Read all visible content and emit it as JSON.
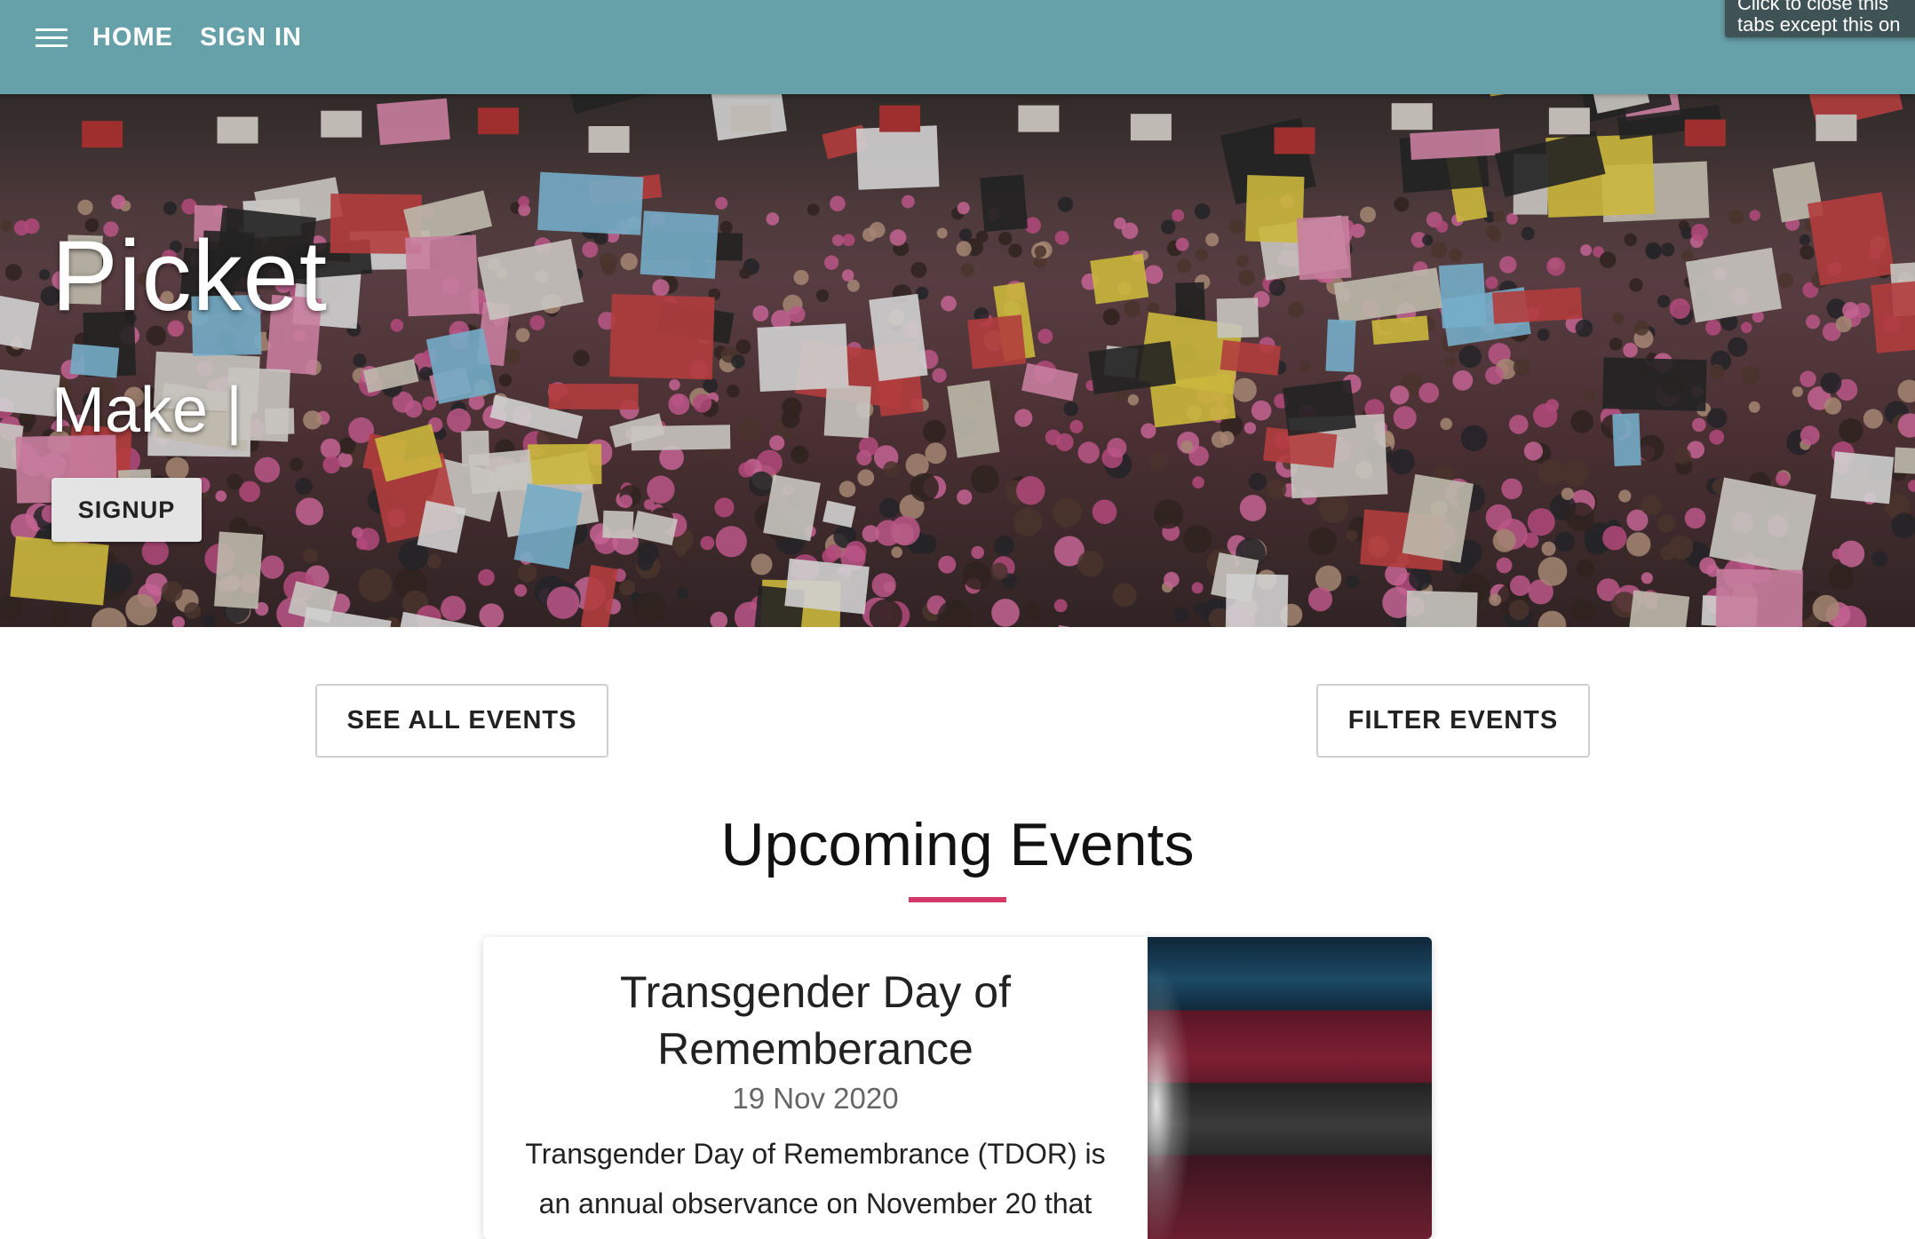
{
  "nav": {
    "menu_icon": "hamburger-menu-icon",
    "home_label": "HOME",
    "signin_label": "SIGN IN"
  },
  "tooltip": {
    "line1": "Click to close this",
    "line2": "tabs except this on"
  },
  "hero": {
    "title": "Picket",
    "subtitle": "Make |",
    "signup_label": "SIGNUP"
  },
  "actions": {
    "see_all_label": "SEE ALL EVENTS",
    "filter_label": "FILTER EVENTS"
  },
  "section": {
    "title": "Upcoming Events",
    "accent_color": "#d63866"
  },
  "events": [
    {
      "title": "Transgender Day of Rememberance",
      "date": "19 Nov 2020",
      "description": "Transgender Day of Remembrance (TDOR) is an annual observance on November 20 that"
    }
  ],
  "colors": {
    "nav_background": "#66a0a8",
    "accent": "#d63866"
  }
}
